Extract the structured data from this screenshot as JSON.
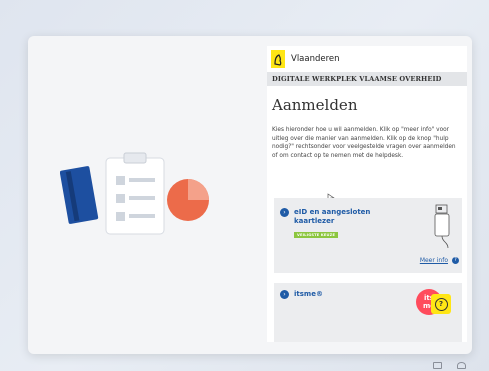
{
  "panel": {
    "brand": "Vlaanderen",
    "band": "DIGITALE WERKPLEK VLAAMSE OVERHEID",
    "title": "Aanmelden",
    "description": "Kies hieronder hoe u wil aanmelden. Klik op \"meer info\" voor uitleg over die manier van aanmelden. Klik op de knop \"hulp nodig?\" rechtsonder voor veelgestelde vragen over aanmelden of om contact op te nemen met de helpdesk."
  },
  "options": {
    "eid": {
      "title_line1": "eID en aangesloten",
      "title_line2": "kaartlezer",
      "tag": "VEILIGSTE KEUZE",
      "more_info": "Meer info"
    },
    "itsme": {
      "title": "itsme®",
      "logo_line1": "its",
      "logo_line2": "me"
    }
  },
  "colors": {
    "accent": "#1f5ba6",
    "flemish_yellow": "#ffe615",
    "tag_green": "#8cc63f",
    "itsme_red": "#ff4b5c"
  }
}
